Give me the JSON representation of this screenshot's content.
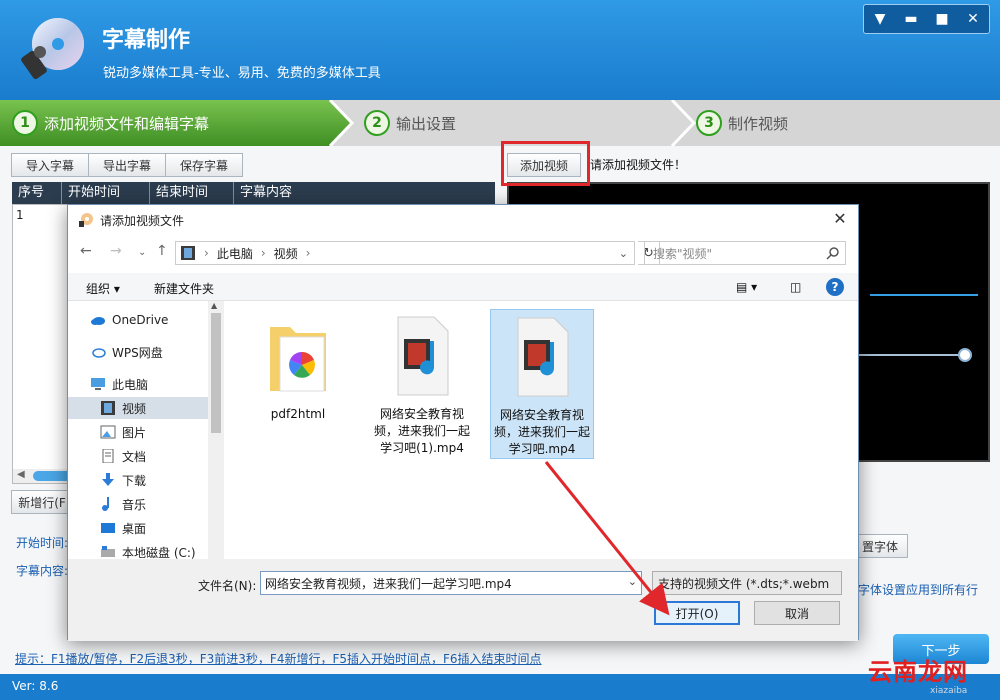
{
  "app": {
    "title": "字幕制作",
    "subtitle": "锐动多媒体工具-专业、易用、免费的多媒体工具",
    "version": "Ver: 8.6"
  },
  "steps": [
    {
      "num": "1",
      "label": "添加视频文件和编辑字幕",
      "active": true
    },
    {
      "num": "2",
      "label": "输出设置",
      "active": false
    },
    {
      "num": "3",
      "label": "制作视频",
      "active": false
    }
  ],
  "toolbar": {
    "import": "导入字幕",
    "export": "导出字幕",
    "save": "保存字幕",
    "add_video": "添加视频",
    "hint": "请添加视频文件！"
  },
  "table": {
    "columns": [
      "序号",
      "开始时间",
      "结束时间",
      "字幕内容"
    ],
    "rows": [
      [
        "1",
        "",
        "",
        ""
      ]
    ]
  },
  "editor": {
    "new_row": "新增行(F",
    "start_label": "开始时间:",
    "content_label": "字幕内容:",
    "font_btn": "置字体",
    "apply_all": "字体设置应用到所有行",
    "next": "下一步"
  },
  "bottom_hint": "提示：F1播放/暂停，F2后退3秒，F3前进3秒，F4新增行，F5插入开始时间点，F6插入结束时间点",
  "watermark": {
    "main": "云南龙网",
    "sub": "xiazaiba"
  },
  "dialog": {
    "title": "请添加视频文件",
    "breadcrumb": [
      "此电脑",
      "视频"
    ],
    "search_placeholder": "搜索\"视频\"",
    "organize": "组织",
    "new_folder": "新建文件夹",
    "nav": [
      {
        "label": "OneDrive",
        "icon": "cloud-icon"
      },
      {
        "label": "WPS网盘",
        "icon": "cloud-outline-icon"
      },
      {
        "label": "此电脑",
        "icon": "computer-icon"
      },
      {
        "label": "视频",
        "icon": "video-folder-icon",
        "selected": true
      },
      {
        "label": "图片",
        "icon": "picture-icon"
      },
      {
        "label": "文档",
        "icon": "document-icon"
      },
      {
        "label": "下载",
        "icon": "download-icon"
      },
      {
        "label": "音乐",
        "icon": "music-icon"
      },
      {
        "label": "桌面",
        "icon": "desktop-icon"
      },
      {
        "label": "本地磁盘 (C:)",
        "icon": "drive-icon"
      }
    ],
    "files": [
      {
        "name": "pdf2html",
        "type": "folder"
      },
      {
        "name": "网络安全教育视频，进来我们一起学习吧(1).mp4",
        "type": "video"
      },
      {
        "name": "网络安全教育视频，进来我们一起学习吧.mp4",
        "type": "video",
        "selected": true
      }
    ],
    "filename_label": "文件名(N):",
    "filename_value": "网络安全教育视频，进来我们一起学习吧.mp4",
    "filter": "支持的视频文件 (*.dts;*.webm",
    "open": "打开(O)",
    "cancel": "取消"
  },
  "colors": {
    "accent": "#1a7ccd",
    "step_active": "#5aa33a",
    "highlight": "#e0272b"
  }
}
